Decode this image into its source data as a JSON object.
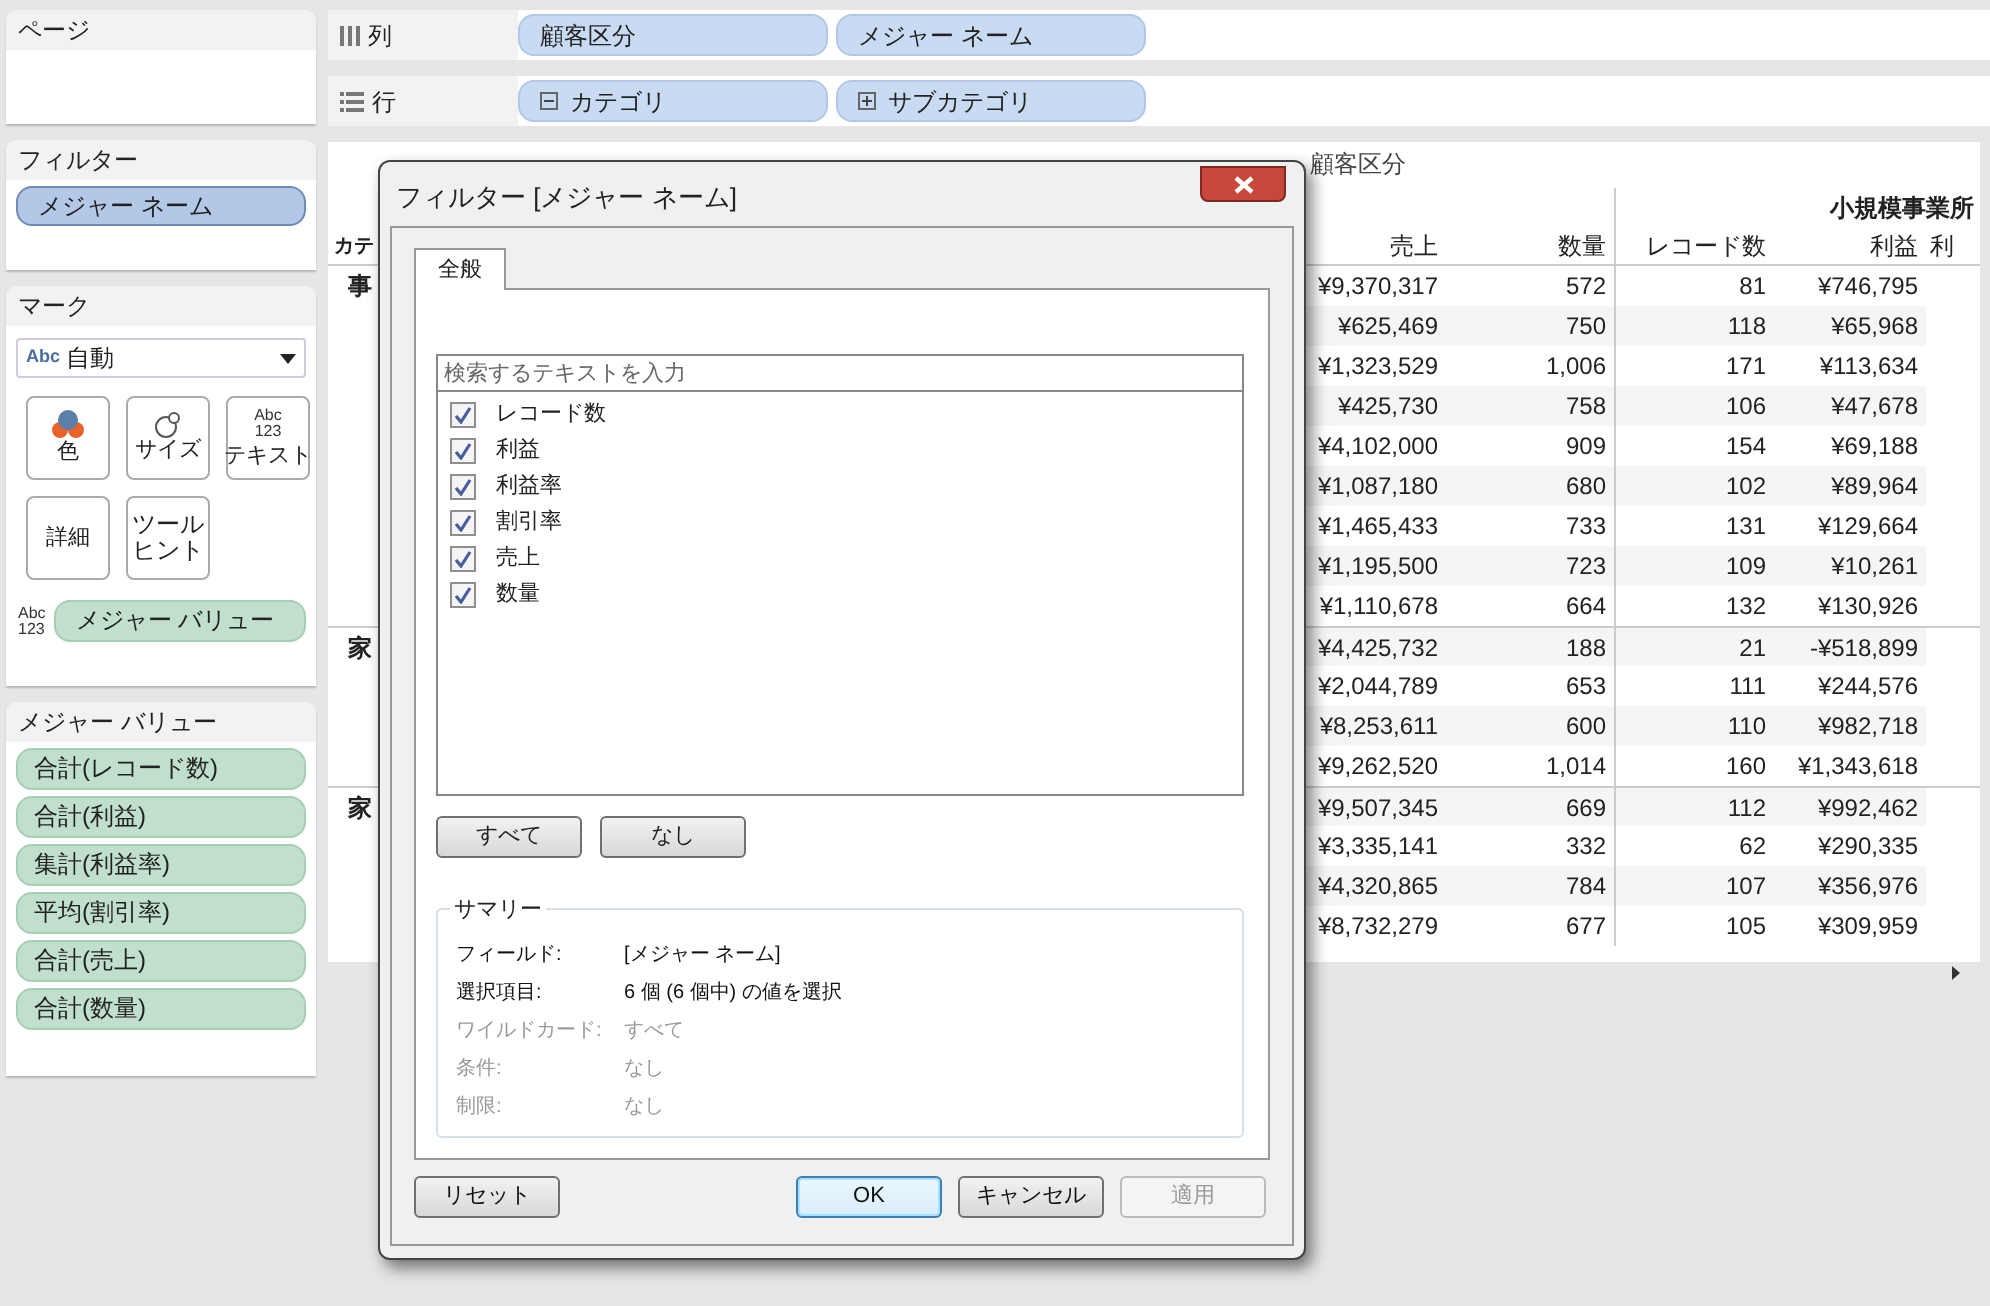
{
  "left_panel": {
    "pages": {
      "title": "ページ"
    },
    "filters": {
      "title": "フィルター",
      "pills": [
        "メジャー ネーム"
      ]
    },
    "marks": {
      "title": "マーク",
      "mark_type": {
        "icon_text": "Abc",
        "label": "自動"
      },
      "buttons": [
        {
          "kind": "color",
          "label": "色"
        },
        {
          "kind": "size",
          "label": "サイズ"
        },
        {
          "kind": "text",
          "label": "テキスト",
          "icon_lines": [
            "Abc",
            "123"
          ]
        },
        {
          "kind": "detail",
          "label": "詳細"
        },
        {
          "kind": "tooltip",
          "label": "ツールヒント"
        }
      ],
      "text_pill": {
        "icon_lines": [
          "Abc",
          "123"
        ],
        "label": "メジャー バリュー"
      }
    },
    "measure_values": {
      "title": "メジャー バリュー",
      "pills": [
        "合計(レコード数)",
        "合計(利益)",
        "集計(利益率)",
        "平均(割引率)",
        "合計(売上)",
        "合計(数量)"
      ]
    }
  },
  "shelves": [
    {
      "kind": "columns",
      "label": "列",
      "pills": [
        {
          "label": "顧客区分"
        },
        {
          "label": "メジャー ネーム"
        }
      ]
    },
    {
      "kind": "rows",
      "label": "行",
      "pills": [
        {
          "label": "カテゴリ",
          "expanded": true
        },
        {
          "label": "サブカテゴリ",
          "expanded": false
        }
      ]
    }
  ],
  "table": {
    "header": "顧客区分",
    "group_header": "小規模事業所",
    "row_header": "カテ",
    "columns": [
      "売上",
      "数量",
      "レコード数",
      "利益",
      "利"
    ],
    "groups": [
      {
        "label": "事",
        "rows": [
          [
            "¥9,370,317",
            "572",
            "81",
            "¥746,795"
          ],
          [
            "¥625,469",
            "750",
            "118",
            "¥65,968"
          ],
          [
            "¥1,323,529",
            "1,006",
            "171",
            "¥113,634"
          ],
          [
            "¥425,730",
            "758",
            "106",
            "¥47,678"
          ],
          [
            "¥4,102,000",
            "909",
            "154",
            "¥69,188"
          ],
          [
            "¥1,087,180",
            "680",
            "102",
            "¥89,964"
          ],
          [
            "¥1,465,433",
            "733",
            "131",
            "¥129,664"
          ],
          [
            "¥1,195,500",
            "723",
            "109",
            "¥10,261"
          ],
          [
            "¥1,110,678",
            "664",
            "132",
            "¥130,926"
          ]
        ]
      },
      {
        "label": "家",
        "rows": [
          [
            "¥4,425,732",
            "188",
            "21",
            "-¥518,899"
          ],
          [
            "¥2,044,789",
            "653",
            "111",
            "¥244,576"
          ],
          [
            "¥8,253,611",
            "600",
            "110",
            "¥982,718"
          ],
          [
            "¥9,262,520",
            "1,014",
            "160",
            "¥1,343,618"
          ]
        ]
      },
      {
        "label": "家",
        "rows": [
          [
            "¥9,507,345",
            "669",
            "112",
            "¥992,462"
          ],
          [
            "¥3,335,141",
            "332",
            "62",
            "¥290,335"
          ],
          [
            "¥4,320,865",
            "784",
            "107",
            "¥356,976"
          ],
          [
            "¥8,732,279",
            "677",
            "105",
            "¥309,959"
          ]
        ]
      }
    ]
  },
  "dialog": {
    "title": "フィルター [メジャー ネーム]",
    "tabs": [
      {
        "label": "全般",
        "selected": true
      }
    ],
    "search": {
      "placeholder": "検索するテキストを入力"
    },
    "items": [
      {
        "label": "レコード数",
        "checked": true
      },
      {
        "label": "利益",
        "checked": true
      },
      {
        "label": "利益率",
        "checked": true
      },
      {
        "label": "割引率",
        "checked": true
      },
      {
        "label": "売上",
        "checked": true
      },
      {
        "label": "数量",
        "checked": true
      }
    ],
    "list_buttons": [
      "すべて",
      "なし"
    ],
    "summary": {
      "title": "サマリー",
      "rows": [
        {
          "label": "フィールド:",
          "value": "[メジャー ネーム]",
          "disabled": false
        },
        {
          "label": "選択項目:",
          "value": "6 個 (6 個中) の値を選択",
          "disabled": false
        },
        {
          "label": "ワイルドカード:",
          "value": "すべて",
          "disabled": true
        },
        {
          "label": "条件:",
          "value": "なし",
          "disabled": true
        },
        {
          "label": "制限:",
          "value": "なし",
          "disabled": true
        }
      ]
    },
    "buttons": [
      {
        "label": "リセット",
        "default": false,
        "disabled": false
      },
      {
        "label": "OK",
        "default": true,
        "disabled": false
      },
      {
        "label": "キャンセル",
        "default": false,
        "disabled": false
      },
      {
        "label": "適用",
        "default": false,
        "disabled": true
      }
    ]
  }
}
